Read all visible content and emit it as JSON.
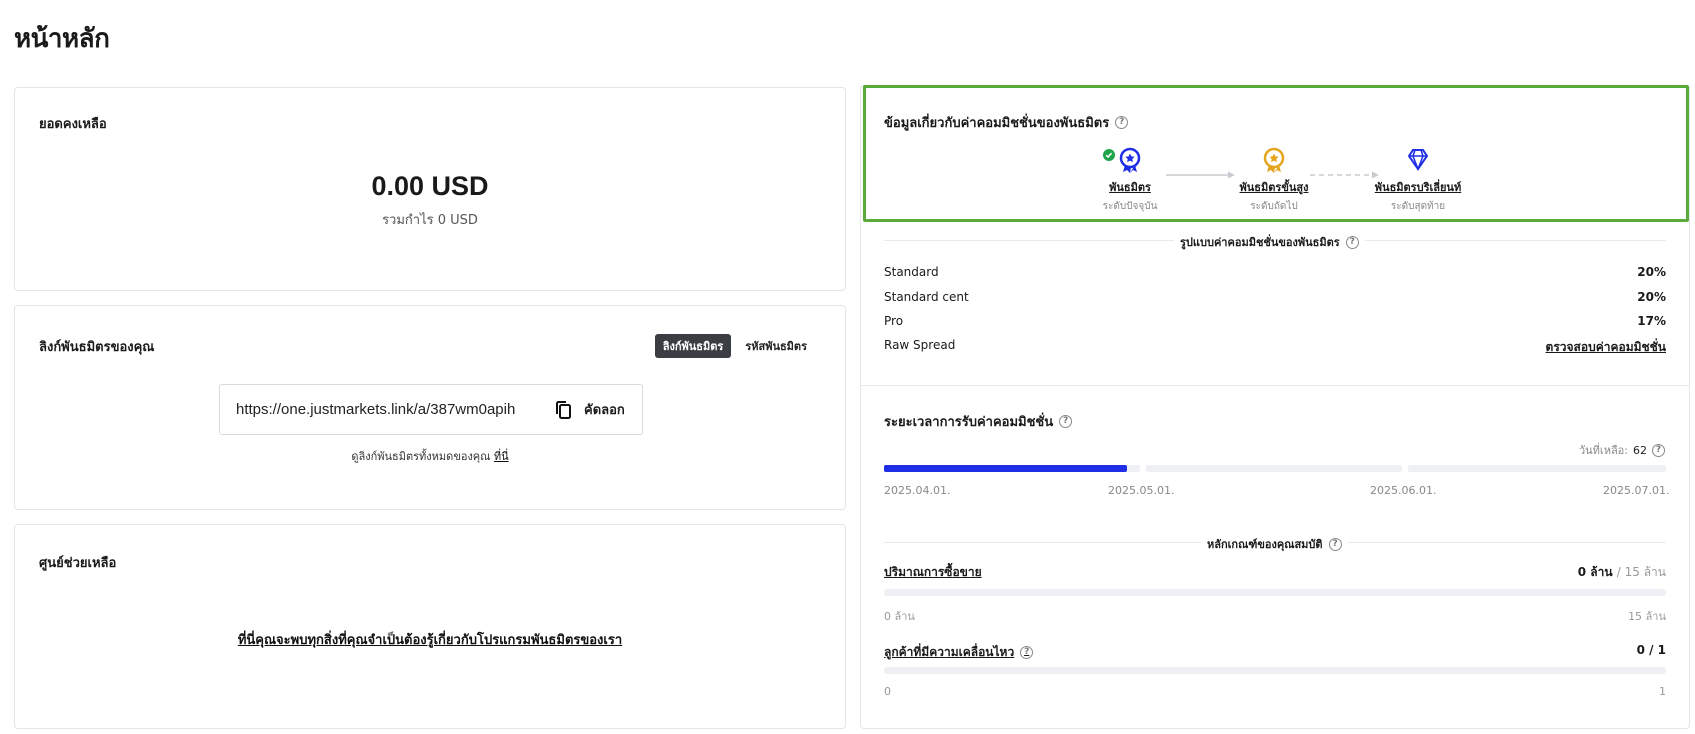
{
  "page": {
    "title": "หน้าหลัก"
  },
  "balance": {
    "title": "ยอดคงเหลือ",
    "amount": "0.00 USD",
    "profit": "รวมกำไร 0 USD"
  },
  "link": {
    "title": "ลิงก์พันธมิตรของคุณ",
    "tabs": [
      {
        "label": "ลิงก์พันธมิตร",
        "active": true
      },
      {
        "label": "รหัสพันธมิตร",
        "active": false
      }
    ],
    "url": "https://one.justmarkets.link/a/387wm0apih",
    "copy_label": "คัดลอก",
    "note_prefix": "ดูลิงก์พันธมิตรทั้งหมดของคุณ",
    "note_link": "ที่นี่"
  },
  "help": {
    "title": "ศูนย์ช่วยเหลือ",
    "link": "ที่นี่คุณจะพบทุกสิ่งที่คุณจำเป็นต้องรู้เกี่ยวกับโปรแกรมพันธมิตรของเรา"
  },
  "commission": {
    "title": "ข้อมูลเกี่ยวกับค่าคอมมิชชั่นของพันธมิตร",
    "tiers": [
      {
        "name": "พันธมิตร",
        "sub": "ระดับปัจจุบัน",
        "color": "#1f2ee6",
        "icon": "medal-icon",
        "current": true
      },
      {
        "name": "พันธมิตรขั้นสูง",
        "sub": "ระดับถัดไป",
        "color": "#e5a41c",
        "icon": "gold-medal-icon",
        "current": false
      },
      {
        "name": "พันธมิตรบริเลี่ยนท์",
        "sub": "ระดับสุดท้าย",
        "color": "#1f2ee6",
        "icon": "diamond-icon",
        "current": false
      }
    ],
    "rates_title": "รูปแบบค่าคอมมิชชั่นของพันธมิตร",
    "rates": [
      {
        "name": "Standard",
        "value": "20%"
      },
      {
        "name": "Standard cent",
        "value": "20%"
      },
      {
        "name": "Pro",
        "value": "17%"
      },
      {
        "name": "Raw Spread",
        "value": "ตรวจสอบค่าคอมมิชชั่น"
      }
    ],
    "period": {
      "title": "ระยะเวลาการรับค่าคอมมิชชั่น",
      "days_label": "วันที่เหลือ:",
      "days_value": "62",
      "progress": 0.95,
      "dates": [
        "2025.04.01.",
        "2025.05.01.",
        "2025.06.01.",
        "2025.07.01."
      ]
    },
    "criteria": {
      "title": "หลักเกณฑ์ของคุณสมบัติ",
      "volume": {
        "name": "ปริมาณการซื้อขาย",
        "current": "0 ล้าน",
        "target": "/ 15 ล้าน",
        "min": "0 ล้าน",
        "max": "15 ล้าน",
        "progress": 0
      },
      "clients": {
        "name": "ลูกค้าที่มีความเคลื่อนไหว",
        "value": "0 / 1",
        "min": "0",
        "max": "1",
        "progress": 0
      }
    }
  },
  "colors": {
    "accent": "#1f2ee6",
    "gold": "#e5a41c",
    "success": "#1fa44a",
    "highlight": "#5aab3a"
  }
}
